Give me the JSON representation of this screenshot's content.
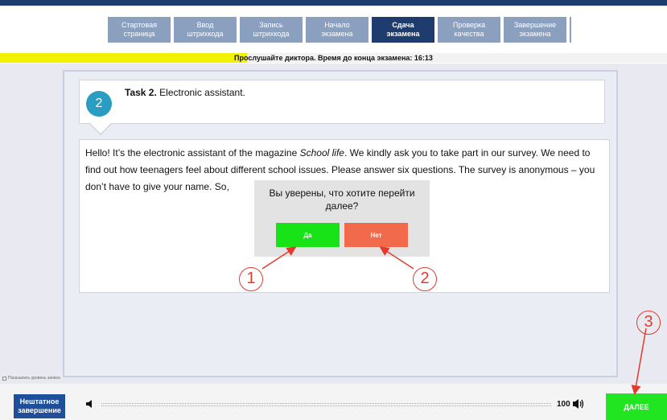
{
  "steps": [
    {
      "label": "Стартовая\nстраница"
    },
    {
      "label": "Ввод\nштрихкода"
    },
    {
      "label": "Запись\nштрихкода"
    },
    {
      "label": "Начало\nэкзамена"
    },
    {
      "label": "Сдача\nэкзамена"
    },
    {
      "label": "Проверка\nкачества"
    },
    {
      "label": "Завершение\nэкзамена"
    }
  ],
  "active_step": 4,
  "progress": {
    "text": "Прослушайте диктора. Время до конца экзамена: 16:13",
    "fill_fraction": 0.37
  },
  "task": {
    "number": "2",
    "title_bold": "Task 2.",
    "title_rest": " Electronic assistant."
  },
  "passage": {
    "part1": "Hello! It’s the electronic assistant of the magazine ",
    "italic": "School life",
    "part2": ". We kindly ask you to take part in our survey. We need to find out how teenagers feel about different school issues. Please answer six questions. The survey is anonymous – you don’t have to give your name. So,"
  },
  "dialog": {
    "question": "Вы уверены, что хотите перейти далее?",
    "yes_label": "Да",
    "no_label": "Нет"
  },
  "level_checkbox_label": "Показывать уровень записи",
  "footer": {
    "abort_label": "Нештатное\nзавершение",
    "volume": "100",
    "next_label": "ДАЛЕЕ"
  },
  "callouts": [
    "1",
    "2",
    "3"
  ],
  "icons": {
    "volume_low": "speaker-icon",
    "volume_high": "speaker-loud-icon"
  },
  "colors": {
    "navy": "#1f3c6e",
    "step_inactive": "#8aa0be",
    "task_badge": "#2a9ec2",
    "yes": "#17e317",
    "no": "#f26a4c",
    "next": "#22e522",
    "callout_red": "#e23b2e",
    "progress_yellow": "#f2f200"
  }
}
